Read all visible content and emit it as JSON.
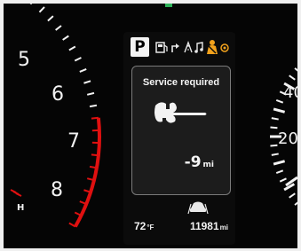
{
  "tachometer": {
    "numbers": [
      "5",
      "6",
      "7",
      "8"
    ],
    "temp_marker": "H"
  },
  "speedometer": {
    "numbers": [
      "40",
      "20"
    ]
  },
  "display": {
    "gear": "P",
    "message": {
      "title": "Service required",
      "distance_value": "-9",
      "distance_unit": "mi"
    },
    "outside_temp": {
      "value": "72",
      "unit": "°F"
    },
    "odometer": {
      "value": "11981",
      "unit": "mi"
    },
    "status_icons": [
      "eco-fuel-icon",
      "turn-arrow-icon",
      "road-icon",
      "music-note-icon",
      "seatbelt-warning-icon",
      "indicator-icon"
    ]
  },
  "colors": {
    "redline": "#e01010",
    "warning_orange": "#f2a21c",
    "text": "#f2f2f2",
    "panel_border": "#7b7b7b"
  }
}
